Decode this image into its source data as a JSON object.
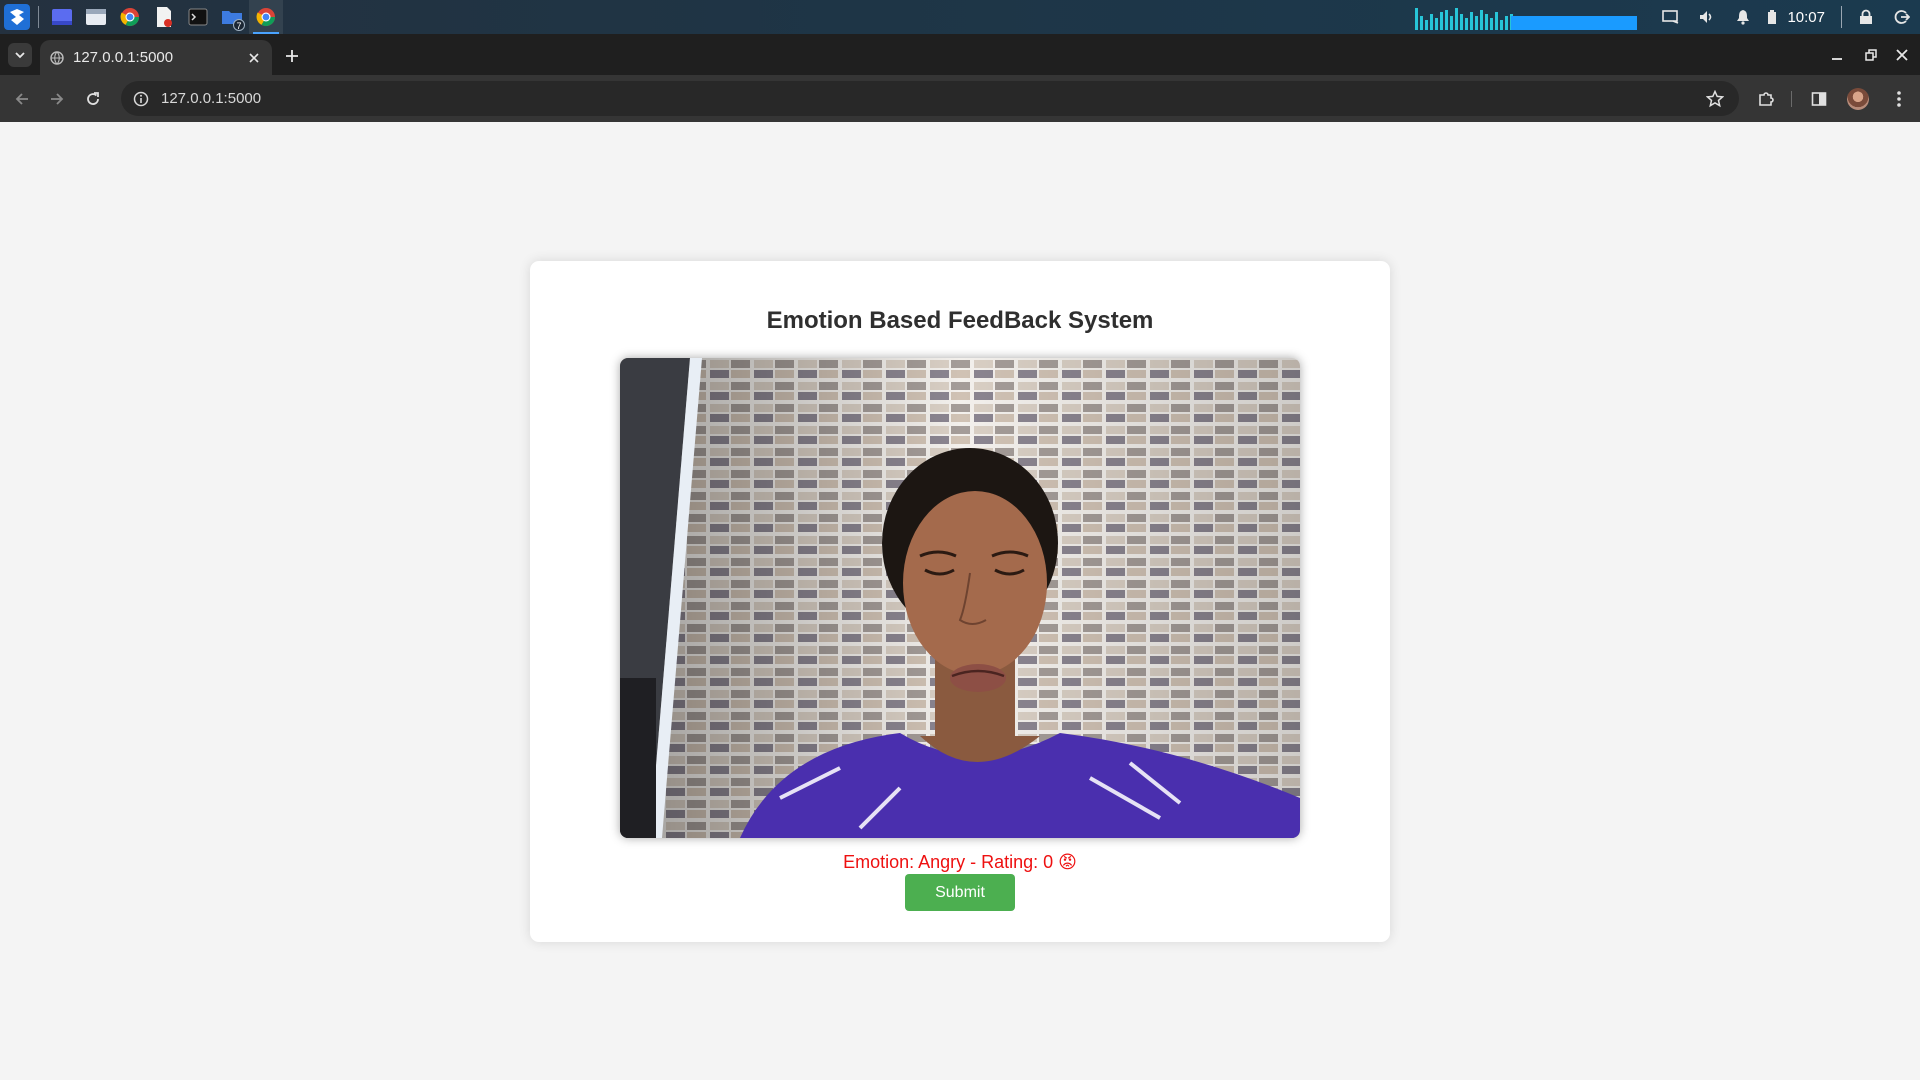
{
  "os_taskbar": {
    "clock": "10:07",
    "badge_count": "7",
    "apps": [
      "launcher-icon",
      "desktop-icon",
      "file-manager-icon",
      "chrome-icon",
      "pdf-editor-icon",
      "terminal-icon",
      "folder-icon",
      "chrome-icon"
    ]
  },
  "browser": {
    "tab_title": "127.0.0.1:5000",
    "url": "127.0.0.1:5000"
  },
  "page": {
    "title": "Emotion Based FeedBack System",
    "emotion_text": "Emotion: Angry - Rating: 0 😡",
    "submit_label": "Submit",
    "webcam_feed": "live camera frame of a person making an angry face against a tiled wall"
  },
  "colors": {
    "emotion_text": "#ee1010",
    "submit_button": "#4caf50",
    "page_background": "#f4f4f4",
    "card_background": "#ffffff"
  }
}
